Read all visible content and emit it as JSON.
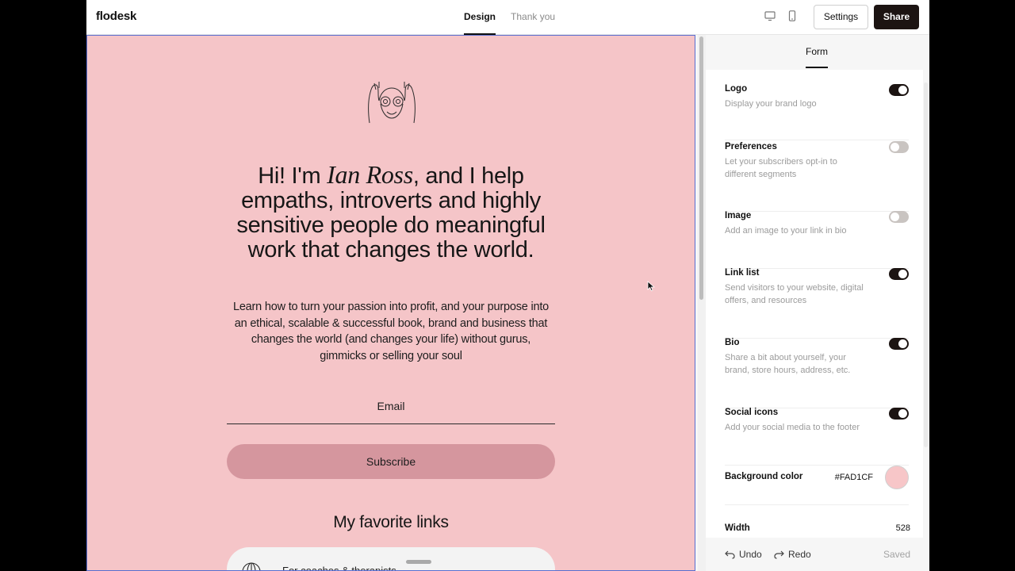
{
  "app": {
    "brand": "flodesk"
  },
  "tabs": [
    {
      "label": "Design",
      "active": true
    },
    {
      "label": "Thank you",
      "active": false
    }
  ],
  "header": {
    "settings_label": "Settings",
    "share_label": "Share"
  },
  "preview": {
    "headline_pre": "Hi! I'm ",
    "headline_name": "Ian Ross",
    "headline_post": ", and I help empaths, introverts and highly sensitive people do meaningful work that changes the world.",
    "subtext": "Learn how to turn your passion into profit, and your purpose into an ethical, scalable & successful book, brand and business that changes the world (and changes your life) without gurus, gimmicks or selling your soul",
    "email_placeholder": "Email",
    "subscribe_label": "Subscribe",
    "links_title": "My favorite links",
    "link_item": "For coaches & therapists"
  },
  "panel": {
    "tab": "Form",
    "settings": [
      {
        "title": "Logo",
        "desc": "Display your brand logo",
        "on": true
      },
      {
        "title": "Preferences",
        "desc": "Let your subscribers opt-in to different segments",
        "on": false
      },
      {
        "title": "Image",
        "desc": "Add an image to your link in bio",
        "on": false
      },
      {
        "title": "Link list",
        "desc": "Send visitors to your website, digital offers, and resources",
        "on": true
      },
      {
        "title": "Bio",
        "desc": "Share a bit about yourself, your brand, store hours, address, etc.",
        "on": true
      },
      {
        "title": "Social icons",
        "desc": "Add your social media to the footer",
        "on": true
      }
    ],
    "background": {
      "label": "Background color",
      "hex": "#FAD1CF"
    },
    "width": {
      "label": "Width",
      "value": "528"
    }
  },
  "footer": {
    "undo": "Undo",
    "redo": "Redo",
    "saved": "Saved"
  },
  "colors": {
    "canvas_bg": "#f5c5c8",
    "button_pink": "#d5969e",
    "dark": "#1c1412"
  }
}
